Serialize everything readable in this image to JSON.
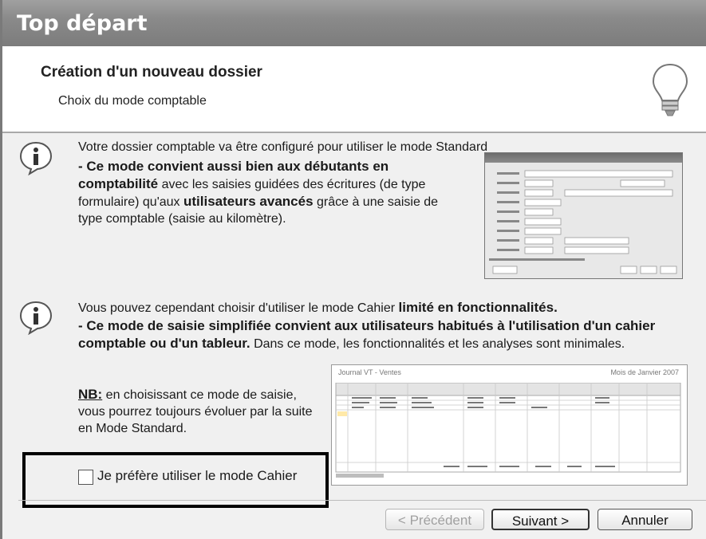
{
  "window": {
    "title": "Top départ"
  },
  "header": {
    "title": "Création d'un nouveau dossier",
    "subtitle": "Choix du mode comptable"
  },
  "info1": {
    "line1": "Votre dossier comptable va être configuré pour utiliser le mode Standard",
    "bold1": "- Ce mode convient aussi bien aux débutants en comptabilité",
    "rest1": " avec les saisies guidées des écritures (de type formulaire) qu'aux ",
    "bold2": "utilisateurs avancés",
    "rest2": " grâce à une saisie de type comptable (saisie au kilomètre)."
  },
  "info2": {
    "line1a": "Vous pouvez cependant choisir d'utiliser le mode Cahier ",
    "line1b": "limité en fonctionnalités.",
    "bold1": "- Ce mode de saisie simplifiée convient aux utilisateurs habitués à l'utilisation d'un cahier comptable ou d'un tableur.",
    "rest1": " Dans ce mode, les fonctionnalités et les analyses sont minimales.",
    "nb": "NB:",
    "nb_rest": " en choisissant ce mode de saisie, vous pourrez toujours évoluer par la suite en Mode Standard."
  },
  "shot2": {
    "title": "Journal VT - Ventes",
    "period": "Mois de Janvier 2007"
  },
  "checkbox": {
    "label": "Je préfère utiliser le mode Cahier"
  },
  "buttons": {
    "prev": "< Précédent",
    "next": "Suivant >",
    "cancel": "Annuler"
  }
}
